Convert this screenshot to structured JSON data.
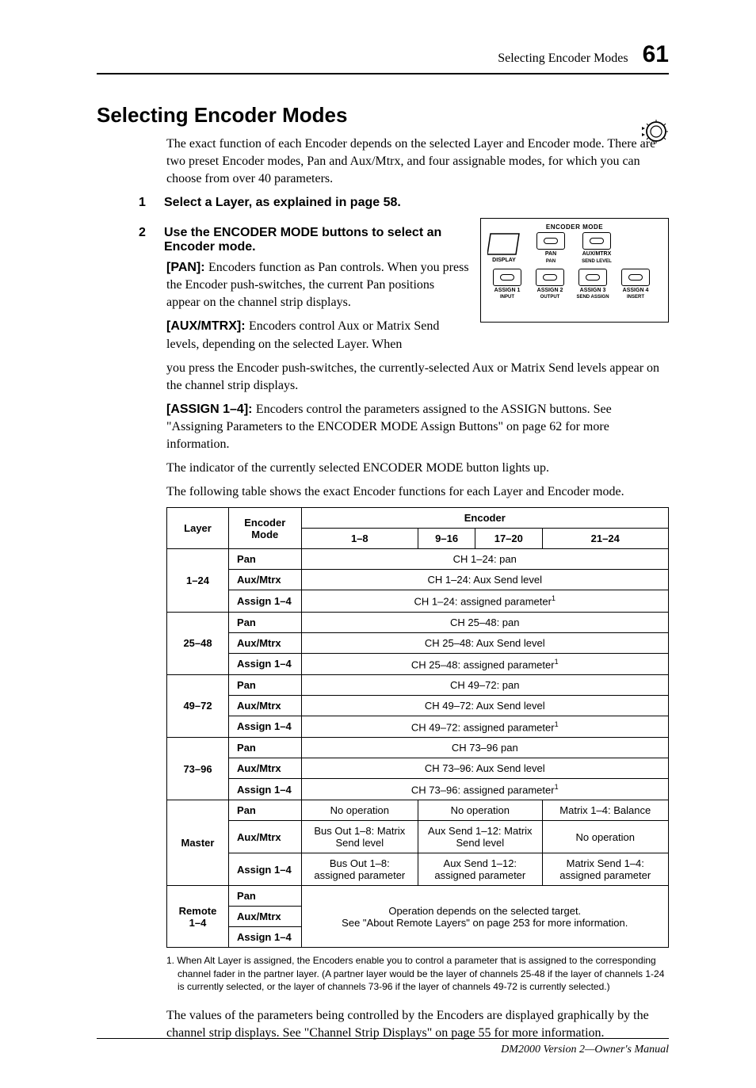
{
  "header": {
    "section_title": "Selecting Encoder Modes",
    "page_number": "61"
  },
  "title": "Selecting Encoder Modes",
  "intro": "The exact function of each Encoder depends on the selected Layer and Encoder mode. There are two preset Encoder modes, Pan and Aux/Mtrx, and four assignable modes, for which you can choose from over 40 parameters.",
  "steps": {
    "s1_num": "1",
    "s1_text": "Select a Layer, as explained in page 58.",
    "s2_num": "2",
    "s2_text": "Use the ENCODER MODE buttons to select an Encoder mode."
  },
  "panel": {
    "title": "ENCODER MODE",
    "display": "DISPLAY",
    "btns": {
      "pan": {
        "lbl": "PAN",
        "sub": "PAN"
      },
      "aux": {
        "lbl": "AUX/MTRX",
        "sub": "SEND LEVEL"
      },
      "a1": {
        "lbl": "ASSIGN 1",
        "sub": "INPUT"
      },
      "a2": {
        "lbl": "ASSIGN 2",
        "sub": "OUTPUT"
      },
      "a3": {
        "lbl": "ASSIGN 3",
        "sub": "SEND ASSIGN"
      },
      "a4": {
        "lbl": "ASSIGN 4",
        "sub": "INSERT"
      }
    }
  },
  "runs": {
    "pan_lbl": "[PAN]: ",
    "pan_body": "Encoders function as Pan controls. When you press the Encoder push-switches, the current Pan positions appear on the channel strip displays.",
    "aux_lbl": "[AUX/MTRX]: ",
    "aux_body1": "Encoders control Aux or Matrix Send levels, depending on the selected Layer. When",
    "aux_body2": "you press the Encoder push-switches, the currently-selected Aux or Matrix Send levels appear on the channel strip displays.",
    "asn_lbl": "[ASSIGN 1–4]: ",
    "asn_body": "Encoders control the parameters assigned to the ASSIGN buttons. See \"Assigning Parameters to the ENCODER MODE Assign Buttons\" on page 62 for more information.",
    "indicator": "The indicator of the currently selected ENCODER MODE button lights up.",
    "table_lead": "The following table shows the exact Encoder functions for each Layer and Encoder mode."
  },
  "table": {
    "h_layer": "Layer",
    "h_encmode": "Encoder Mode",
    "h_enc": "Encoder",
    "h_c1": "1–8",
    "h_c2": "9–16",
    "h_c3": "17–20",
    "h_c4": "21–24",
    "mode_pan": "Pan",
    "mode_aux": "Aux/Mtrx",
    "mode_asn": "Assign 1–4",
    "layers": {
      "l1": "1–24",
      "l2": "25–48",
      "l3": "49–72",
      "l4": "73–96",
      "lm": "Master",
      "lr": "Remote 1–4"
    },
    "rows": {
      "r1": "CH 1–24: pan",
      "r2": "CH 1–24: Aux Send level",
      "r3": "CH 1–24: assigned parameter",
      "r4": "CH 25–48: pan",
      "r5": "CH 25–48: Aux Send level",
      "r6": "CH 25–48: assigned parameter",
      "r7": "CH 49–72: pan",
      "r8": "CH 49–72: Aux Send level",
      "r9": "CH 49–72: assigned parameter",
      "r10": "CH 73–96 pan",
      "r11": "CH 73–96: Aux Send level",
      "r12": "CH 73–96: assigned parameter",
      "m1a": "No operation",
      "m1b": "No operation",
      "m1c": "Matrix 1–4: Balance",
      "m2a": "Bus Out 1–8: Matrix Send level",
      "m2b": "Aux Send 1–12: Matrix Send level",
      "m2c": "No operation",
      "m3a": "Bus Out 1–8: assigned parameter",
      "m3b": "Aux Send 1–12: assigned parameter",
      "m3c": "Matrix Send 1–4: assigned parameter",
      "remote": "Operation depends on the selected target.\nSee \"About Remote Layers\" on page 253 for more information."
    },
    "sup": "1"
  },
  "footnote_num": "1. ",
  "footnote": "When Alt Layer is assigned, the Encoders enable you to control a parameter that is assigned to the corresponding channel fader in the partner layer. (A partner layer would be the layer of channels 25-48 if the layer of channels 1-24 is currently selected, or the layer of channels 73-96 if the layer of channels 49-72 is currently selected.)",
  "closing": "The values of the parameters being controlled by the Encoders are displayed graphically by the channel strip displays. See \"Channel Strip Displays\" on page 55 for more information.",
  "footer": "DM2000 Version 2—Owner's Manual"
}
